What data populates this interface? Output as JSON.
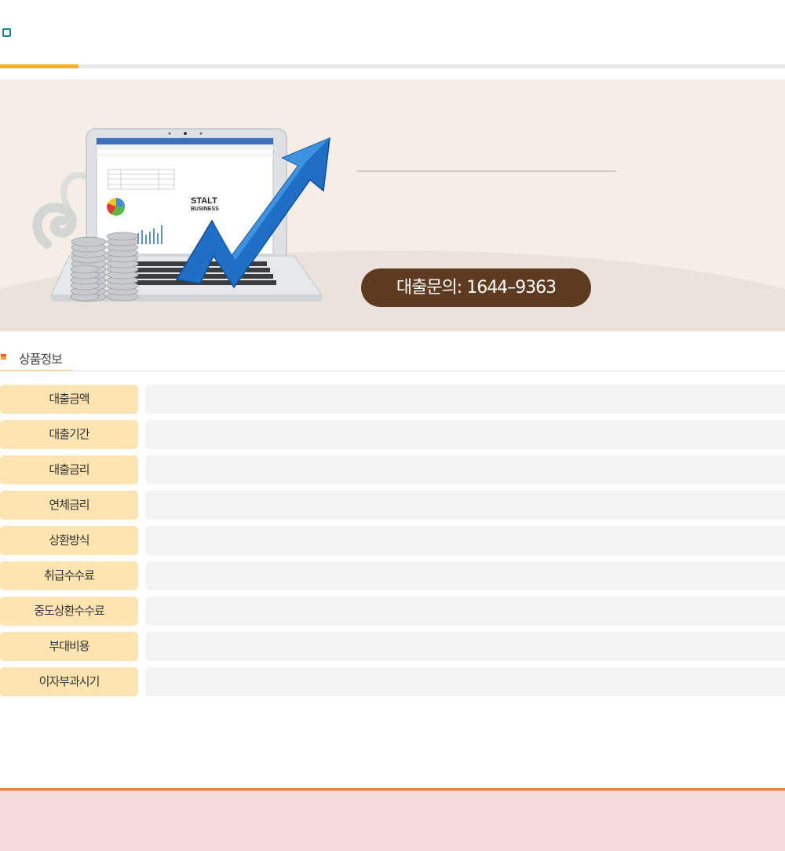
{
  "banner": {
    "phone_label": "대출문의: 1644–9363",
    "laptop_text_1": "STALT",
    "laptop_text_2": "BUSINESS"
  },
  "section": {
    "title": "상품정보"
  },
  "rows": [
    {
      "label": "대출금액",
      "value": ""
    },
    {
      "label": "대출기간",
      "value": ""
    },
    {
      "label": "대출금리",
      "value": ""
    },
    {
      "label": "연체금리",
      "value": ""
    },
    {
      "label": "상환방식",
      "value": ""
    },
    {
      "label": "취급수수료",
      "value": ""
    },
    {
      "label": "중도상환수수료",
      "value": ""
    },
    {
      "label": "부대비용",
      "value": ""
    },
    {
      "label": "이자부과시기",
      "value": ""
    }
  ],
  "colors": {
    "accent_yellow": "#f5b31f",
    "pill_brown": "#5e3a21",
    "label_bg": "#fee4b0",
    "footer_orange": "#ec7a1e",
    "footer_bg": "#f6dadd"
  }
}
